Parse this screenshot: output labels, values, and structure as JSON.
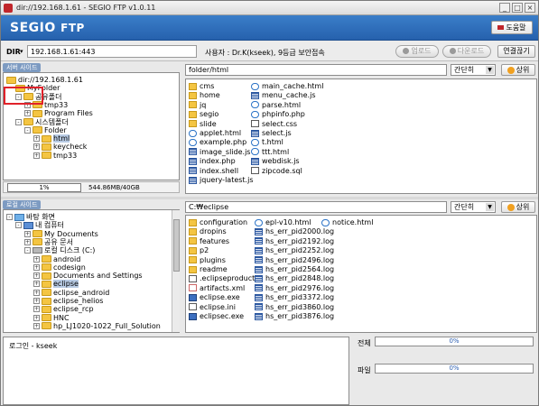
{
  "window": {
    "title": "dir://192.168.1.61 - SEGIO FTP v1.0.11",
    "minimize": "_",
    "maximize": "□",
    "close": "×"
  },
  "header": {
    "logo_main": "SEGIO",
    "logo_ftp": "FTP",
    "help_label": "도움말"
  },
  "dirbar": {
    "label": "DIR",
    "caret": "▾",
    "value": "192.168.1.61:443",
    "user_info": "사용자 : Dr.K(kseek), 9등급 보안접속",
    "upload_label": "업로드",
    "download_label": "다운로드",
    "connect_label": "연결끊기"
  },
  "server": {
    "section_label": "서버 사이드",
    "tree": [
      {
        "label": "dir://192.168.1.61",
        "level": 0,
        "icon": "folder",
        "expander": ""
      },
      {
        "label": "MyFolder",
        "level": 1,
        "icon": "folder",
        "expander": ""
      },
      {
        "label": "공유폴더",
        "level": 1,
        "icon": "folder",
        "expander": "-"
      },
      {
        "label": "tmp33",
        "level": 2,
        "icon": "folder",
        "expander": "+"
      },
      {
        "label": "Program Files",
        "level": 2,
        "icon": "folder",
        "expander": "+"
      },
      {
        "label": "시스템폴더",
        "level": 1,
        "icon": "folder",
        "expander": "-"
      },
      {
        "label": "Folder",
        "level": 2,
        "icon": "folder",
        "expander": "-"
      },
      {
        "label": "html",
        "level": 3,
        "icon": "folder",
        "expander": "+",
        "selected": true
      },
      {
        "label": "keycheck",
        "level": 3,
        "icon": "folder",
        "expander": "+"
      },
      {
        "label": "tmp33",
        "level": 3,
        "icon": "folder",
        "expander": "+"
      }
    ],
    "usage_percent": "1%",
    "usage_text": "544.86MB/40GB",
    "path": "folder/html",
    "view_mode": "간단히",
    "up_label": "상위",
    "files_col1": [
      {
        "name": "cms",
        "icon": "folder"
      },
      {
        "name": "home",
        "icon": "folder"
      },
      {
        "name": "jq",
        "icon": "folder"
      },
      {
        "name": "segio",
        "icon": "folder"
      },
      {
        "name": "slide",
        "icon": "folder"
      },
      {
        "name": "applet.html",
        "icon": "ie"
      },
      {
        "name": "example.php",
        "icon": "ie"
      },
      {
        "name": "image_slide.js",
        "icon": "grid"
      },
      {
        "name": "index.php",
        "icon": "grid"
      },
      {
        "name": "index.shell",
        "icon": "grid"
      },
      {
        "name": "jquery-latest.js",
        "icon": "grid"
      }
    ],
    "files_col2": [
      {
        "name": "main_cache.html",
        "icon": "ie"
      },
      {
        "name": "menu_cache.js",
        "icon": "grid"
      },
      {
        "name": "parse.html",
        "icon": "ie"
      },
      {
        "name": "phpinfo.php",
        "icon": "ie"
      },
      {
        "name": "select.css",
        "icon": "doc"
      },
      {
        "name": "select.js",
        "icon": "grid"
      },
      {
        "name": "t.html",
        "icon": "ie"
      },
      {
        "name": "ttt.html",
        "icon": "ie"
      },
      {
        "name": "webdisk.js",
        "icon": "grid"
      },
      {
        "name": "zipcode.sql",
        "icon": "doc"
      }
    ]
  },
  "local": {
    "section_label": "로컬 사이드",
    "tree": [
      {
        "label": "바탕 화면",
        "level": 0,
        "icon": "desktop",
        "expander": "-"
      },
      {
        "label": "내 컴퓨터",
        "level": 1,
        "icon": "computer",
        "expander": "-"
      },
      {
        "label": "My Documents",
        "level": 2,
        "icon": "folder",
        "expander": "+"
      },
      {
        "label": "공유 문서",
        "level": 2,
        "icon": "folder",
        "expander": "+"
      },
      {
        "label": "로컬 디스크 (C:)",
        "level": 2,
        "icon": "drive",
        "expander": "-"
      },
      {
        "label": "android",
        "level": 3,
        "icon": "folder",
        "expander": "+"
      },
      {
        "label": "codesign",
        "level": 3,
        "icon": "folder",
        "expander": "+"
      },
      {
        "label": "Documents and Settings",
        "level": 3,
        "icon": "folder",
        "expander": "+"
      },
      {
        "label": "eclipse",
        "level": 3,
        "icon": "folder",
        "expander": "+",
        "selected": true
      },
      {
        "label": "eclipse_android",
        "level": 3,
        "icon": "folder",
        "expander": "+"
      },
      {
        "label": "eclipse_helios",
        "level": 3,
        "icon": "folder",
        "expander": "+"
      },
      {
        "label": "eclipse_rcp",
        "level": 3,
        "icon": "folder",
        "expander": "+"
      },
      {
        "label": "HNC",
        "level": 3,
        "icon": "folder",
        "expander": "+"
      },
      {
        "label": "hp_LJ1020-1022_Full_Solution",
        "level": 3,
        "icon": "folder",
        "expander": "+"
      }
    ],
    "path": "C:₩eclipse",
    "view_mode": "간단히",
    "up_label": "상위",
    "files_col1": [
      {
        "name": "configuration",
        "icon": "folder"
      },
      {
        "name": "dropins",
        "icon": "folder"
      },
      {
        "name": "features",
        "icon": "folder"
      },
      {
        "name": "p2",
        "icon": "folder"
      },
      {
        "name": "plugins",
        "icon": "folder"
      },
      {
        "name": "readme",
        "icon": "folder"
      },
      {
        "name": ".eclipseproduct",
        "icon": "doc"
      },
      {
        "name": "artifacts.xml",
        "icon": "xml"
      },
      {
        "name": "eclipse.exe",
        "icon": "exe"
      },
      {
        "name": "eclipse.ini",
        "icon": "doc"
      },
      {
        "name": "eclipsec.exe",
        "icon": "exe"
      }
    ],
    "files_col2": [
      {
        "name": "epl-v10.html",
        "icon": "ie"
      },
      {
        "name": "hs_err_pid2000.log",
        "icon": "grid"
      },
      {
        "name": "hs_err_pid2192.log",
        "icon": "grid"
      },
      {
        "name": "hs_err_pid2252.log",
        "icon": "grid"
      },
      {
        "name": "hs_err_pid2496.log",
        "icon": "grid"
      },
      {
        "name": "hs_err_pid2564.log",
        "icon": "grid"
      },
      {
        "name": "hs_err_pid2848.log",
        "icon": "grid"
      },
      {
        "name": "hs_err_pid2976.log",
        "icon": "grid"
      },
      {
        "name": "hs_err_pid3372.log",
        "icon": "grid"
      },
      {
        "name": "hs_err_pid3860.log",
        "icon": "grid"
      },
      {
        "name": "hs_err_pid3876.log",
        "icon": "grid"
      }
    ],
    "files_col3": [
      {
        "name": "notice.html",
        "icon": "ie"
      }
    ]
  },
  "log": {
    "text": "로그인 - kseek"
  },
  "progress": {
    "total_label": "전체",
    "total_value": "0%",
    "total_fraction": 0,
    "file_label": "파일",
    "file_value": "0%",
    "file_fraction": 0
  },
  "colors": {
    "header": "#2f6fbd",
    "highlight": "#e0212a",
    "selection": "#b8cbe4"
  }
}
